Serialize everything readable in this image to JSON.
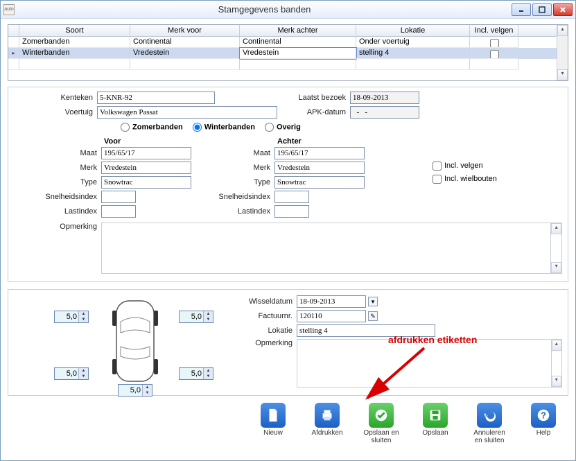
{
  "window": {
    "title": "Stamgegevens banden",
    "appicon_label": "auto"
  },
  "grid": {
    "headers": {
      "soort": "Soort",
      "merk_voor": "Merk voor",
      "merk_achter": "Merk achter",
      "lokatie": "Lokatie",
      "incl": "Incl. velgen"
    },
    "rows": [
      {
        "soort": "Zomerbanden",
        "merk_voor": "Continental",
        "merk_achter": "Continental",
        "lokatie": "Onder voertuig",
        "incl": false,
        "sel": false
      },
      {
        "soort": "Winterbanden",
        "merk_voor": "Vredestein",
        "merk_achter": "Vredestein",
        "lokatie": "stelling 4",
        "incl": false,
        "sel": true
      }
    ]
  },
  "top_form": {
    "kenteken_lbl": "Kenteken",
    "kenteken": "5-KNR-92",
    "voertuig_lbl": "Voertuig",
    "voertuig": "Volkswagen Passat",
    "laatst_lbl": "Laatst bezoek",
    "laatst": "18-09-2013",
    "apk_lbl": "APK-datum",
    "apk": "  -   -",
    "radios": {
      "zomer": "Zomerbanden",
      "winter": "Winterbanden",
      "overig": "Overig",
      "selected": "winter"
    }
  },
  "tire_form": {
    "voor_head": "Voor",
    "achter_head": "Achter",
    "labels": {
      "maat": "Maat",
      "merk": "Merk",
      "type": "Type",
      "snel": "Snelheidsindex",
      "last": "Lastindex"
    },
    "voor": {
      "maat": "195/65/17",
      "merk": "Vredestein",
      "type": "Snowtrac",
      "snel": "",
      "last": ""
    },
    "achter": {
      "maat": "195/65/17",
      "merk": "Vredestein",
      "type": "Snowtrac",
      "snel": "",
      "last": ""
    },
    "checks": {
      "velgen": "Incl. velgen",
      "wielbout": "Incl. wielbouten"
    },
    "opmerking_lbl": "Opmerking",
    "opmerking": ""
  },
  "car": {
    "depths": {
      "fl": "5,0",
      "fr": "5,0",
      "rl": "5,0",
      "rr": "5,0",
      "sp": "5,0"
    }
  },
  "wissel": {
    "datum_lbl": "Wisseldatum",
    "datum": "18-09-2013",
    "factuur_lbl": "Factuurnr.",
    "factuur": "120110",
    "lokatie_lbl": "Lokatie",
    "lokatie": "stelling 4",
    "opmerking_lbl": "Opmerking",
    "opmerking": ""
  },
  "callout": "afdrukken etiketten",
  "buttons": {
    "nieuw": "Nieuw",
    "afdrukken": "Afdrukken",
    "opslaan_sluiten": "Opslaan en sluiten",
    "opslaan": "Opslaan",
    "annuleren": "Annuleren en sluiten",
    "help": "Help"
  }
}
